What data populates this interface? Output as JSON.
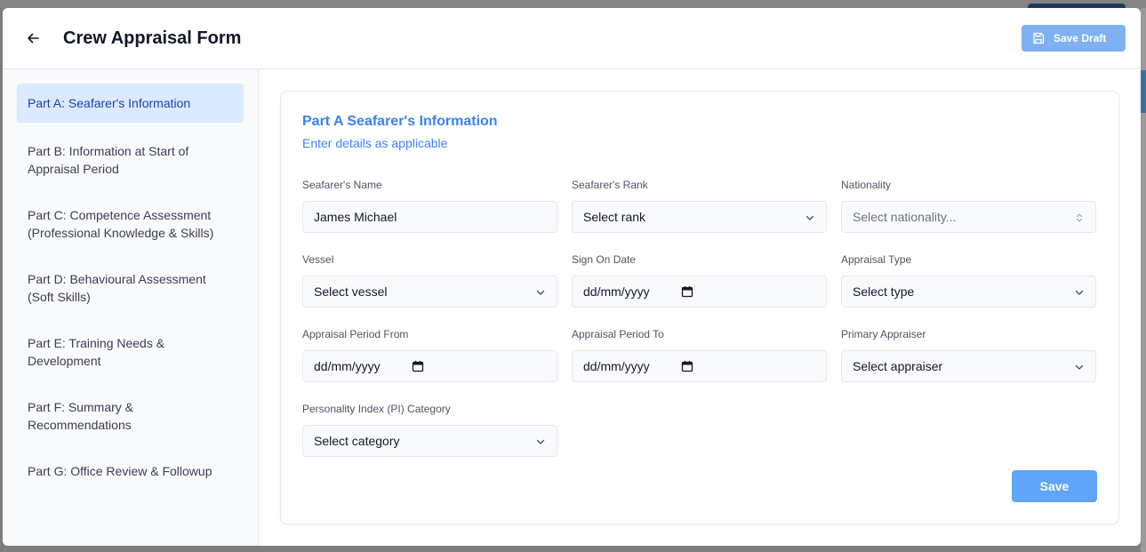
{
  "header": {
    "title": "Crew Appraisal Form",
    "save_draft_label": "Save Draft"
  },
  "sidebar": {
    "items": [
      {
        "label": "Part A: Seafarer's Information",
        "active": true
      },
      {
        "label": "Part B: Information at Start of Appraisal Period",
        "active": false
      },
      {
        "label": "Part C: Competence Assessment (Professional Knowledge & Skills)",
        "active": false
      },
      {
        "label": "Part D: Behavioural Assessment (Soft Skills)",
        "active": false
      },
      {
        "label": "Part E: Training Needs & Development",
        "active": false
      },
      {
        "label": "Part F: Summary & Recommendations",
        "active": false
      },
      {
        "label": "Part G: Office Review & Followup",
        "active": false
      }
    ]
  },
  "section": {
    "title": "Part A Seafarer's Information",
    "subtitle": "Enter details as applicable"
  },
  "fields": {
    "name": {
      "label": "Seafarer's Name",
      "value": "James Michael"
    },
    "rank": {
      "label": "Seafarer's Rank",
      "value": "Select rank"
    },
    "nationality": {
      "label": "Nationality",
      "value": "Select nationality..."
    },
    "vessel": {
      "label": "Vessel",
      "value": "Select vessel"
    },
    "sign_on": {
      "label": "Sign On Date",
      "value": "dd/mm/yyyy"
    },
    "appraisal_type": {
      "label": "Appraisal Type",
      "value": "Select type"
    },
    "period_from": {
      "label": "Appraisal Period From",
      "value": "dd/mm/yyyy"
    },
    "period_to": {
      "label": "Appraisal Period To",
      "value": "dd/mm/yyyy"
    },
    "primary_appraiser": {
      "label": "Primary Appraiser",
      "value": "Select appraiser"
    },
    "pi_category": {
      "label": "Personality Index (PI) Category",
      "value": "Select category"
    }
  },
  "actions": {
    "save_label": "Save"
  },
  "colors": {
    "accent": "#3b82f6",
    "active_nav_bg": "#dbeafe",
    "save_button": "#60a5fa",
    "save_draft_button": "#7fb0f3"
  },
  "icons": {
    "back": "arrow-left-icon",
    "save_draft": "floppy-disk-icon",
    "select": "chevron-down-icon",
    "combobox": "chevron-up-down-icon",
    "date": "calendar-icon"
  }
}
